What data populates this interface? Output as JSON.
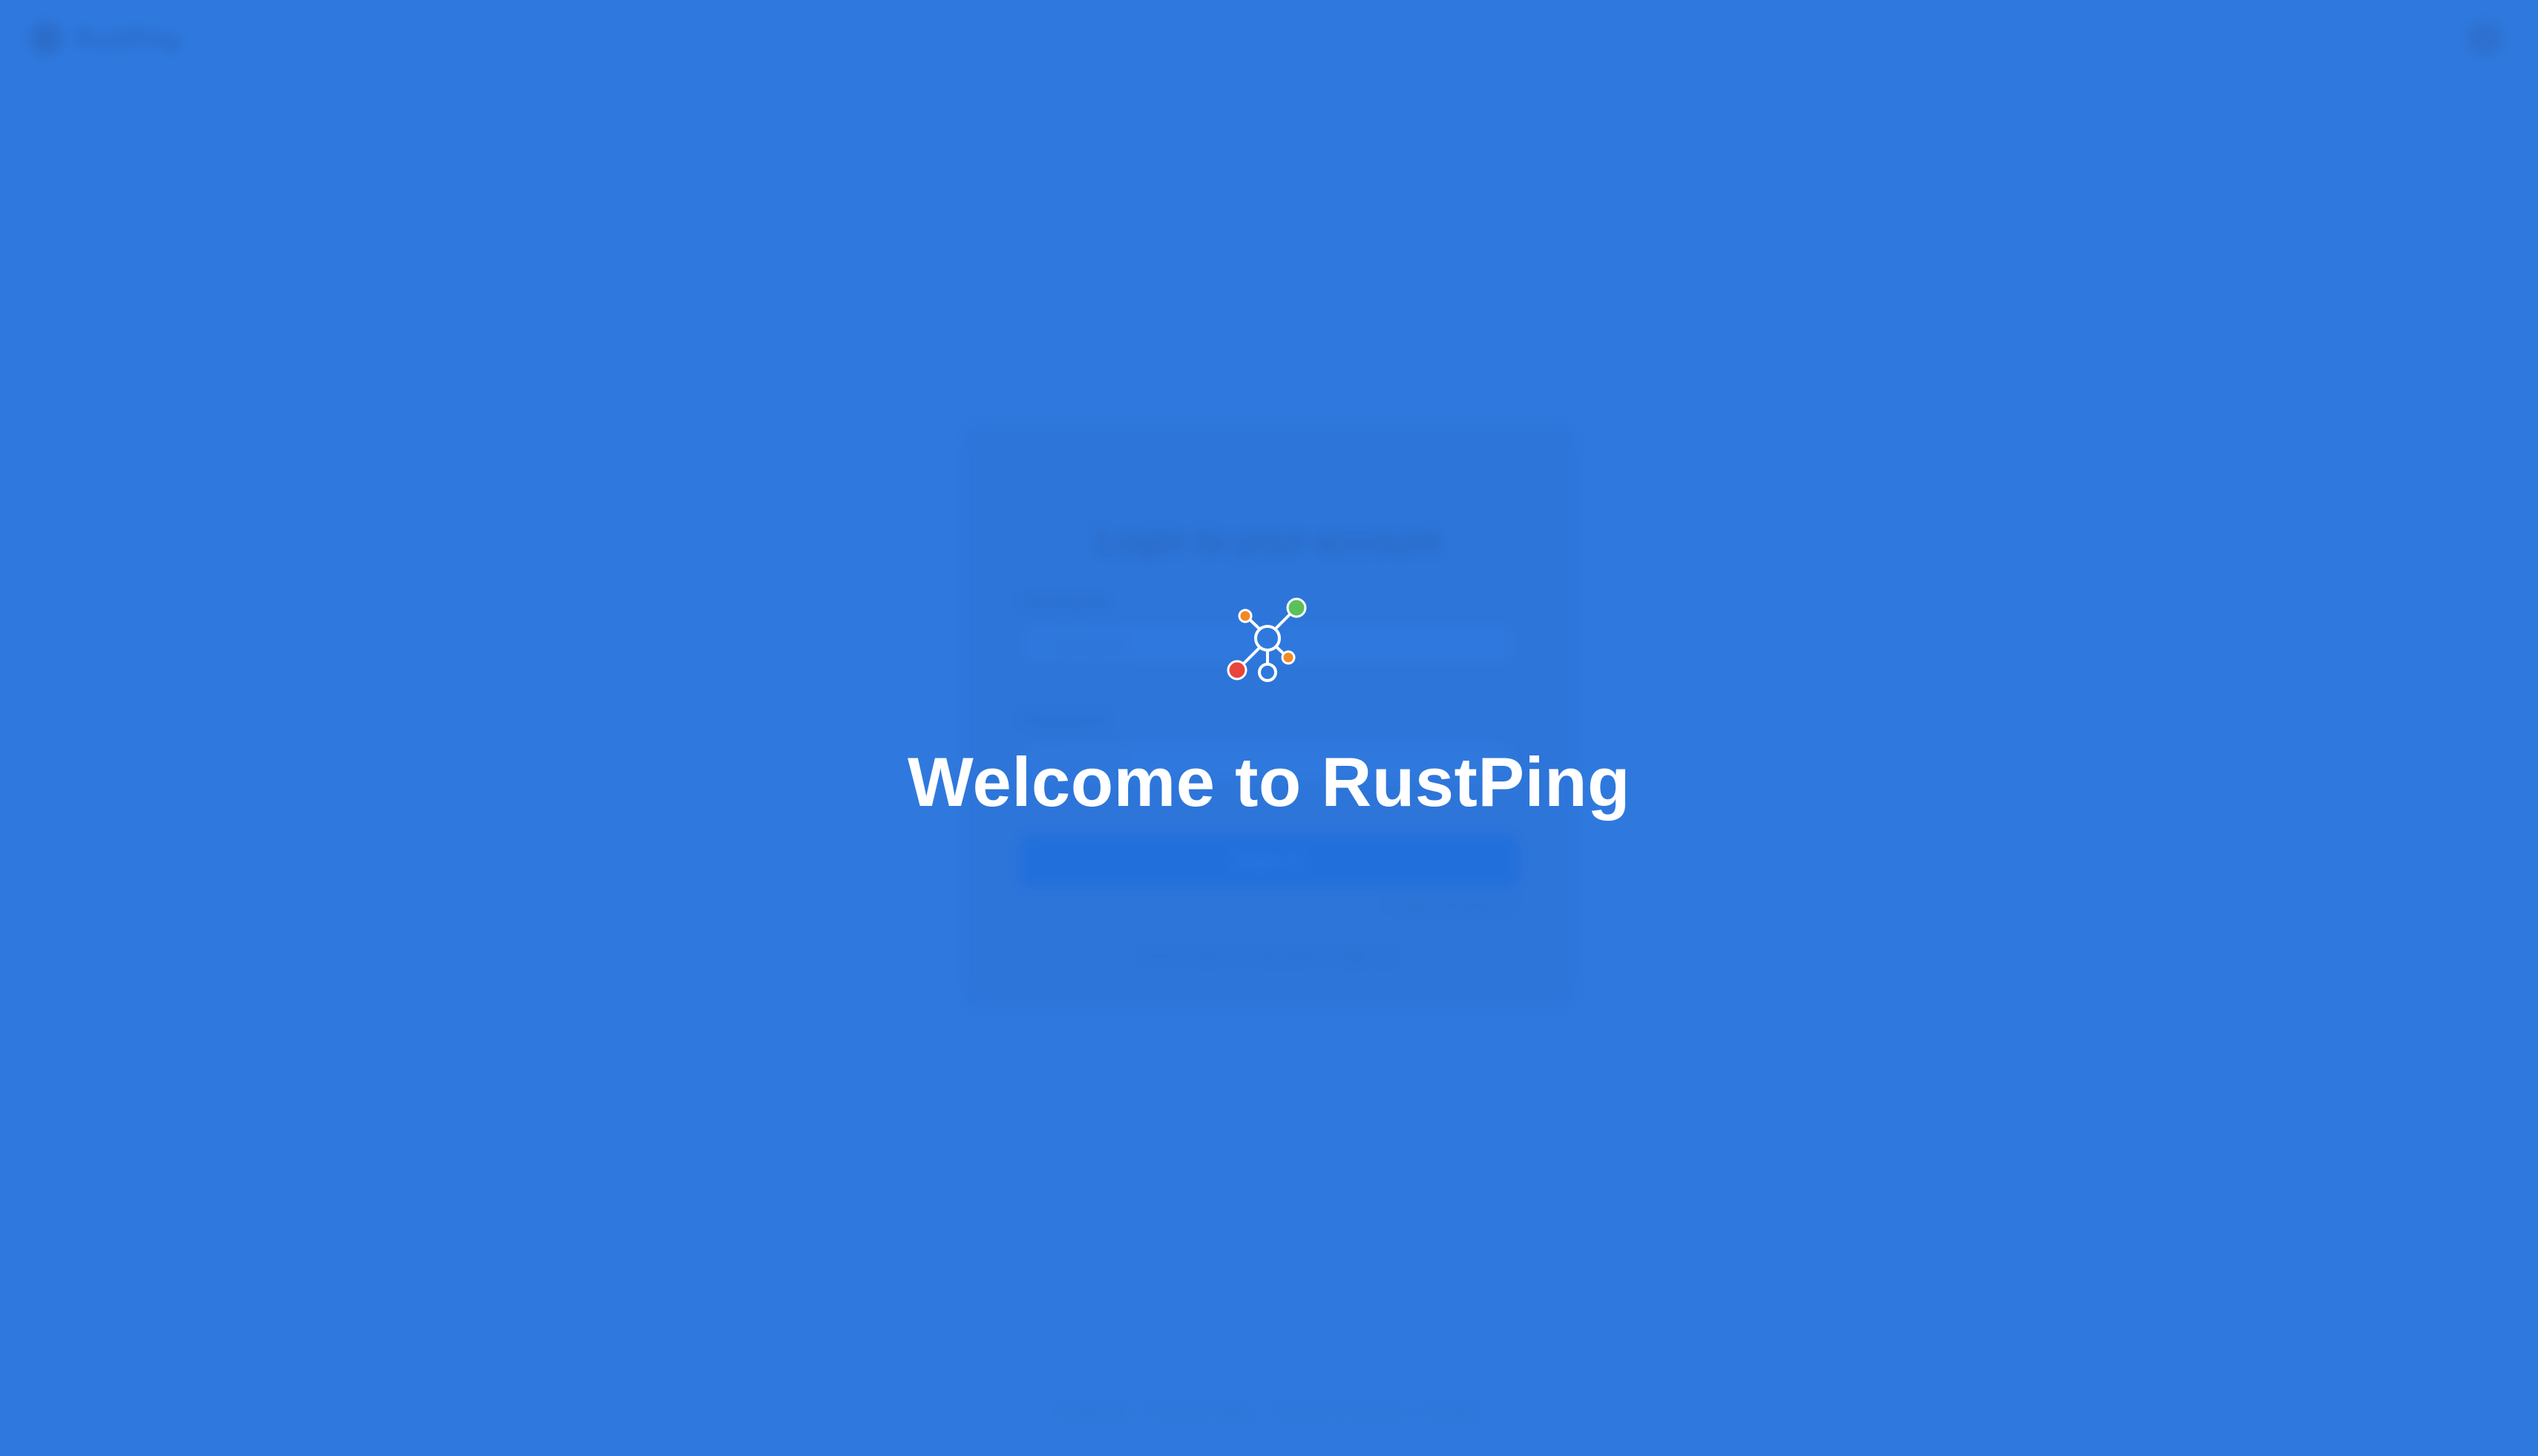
{
  "app": {
    "name": "RustPing"
  },
  "splash": {
    "title": "Welcome to RustPing",
    "logo_icon": "network-nodes-icon"
  },
  "background": {
    "login_card": {
      "title": "Login to your account",
      "username_label": "Username",
      "username_placeholder": "Username",
      "password_label": "Password",
      "password_placeholder": "Password",
      "sign_in_button": "Sign in",
      "forgot_link": "Forgot password?",
      "signup_text": "Don't have an account? Sign up"
    },
    "footer_text": "RustPing · Privacy Policy · Terms of Service · Contact"
  },
  "colors": {
    "background": "#2f79de",
    "title": "#ffffff",
    "node_green": "#5cc05a",
    "node_red": "#e8453c",
    "node_orange": "#f08a24",
    "node_outline": "#ffffff"
  }
}
